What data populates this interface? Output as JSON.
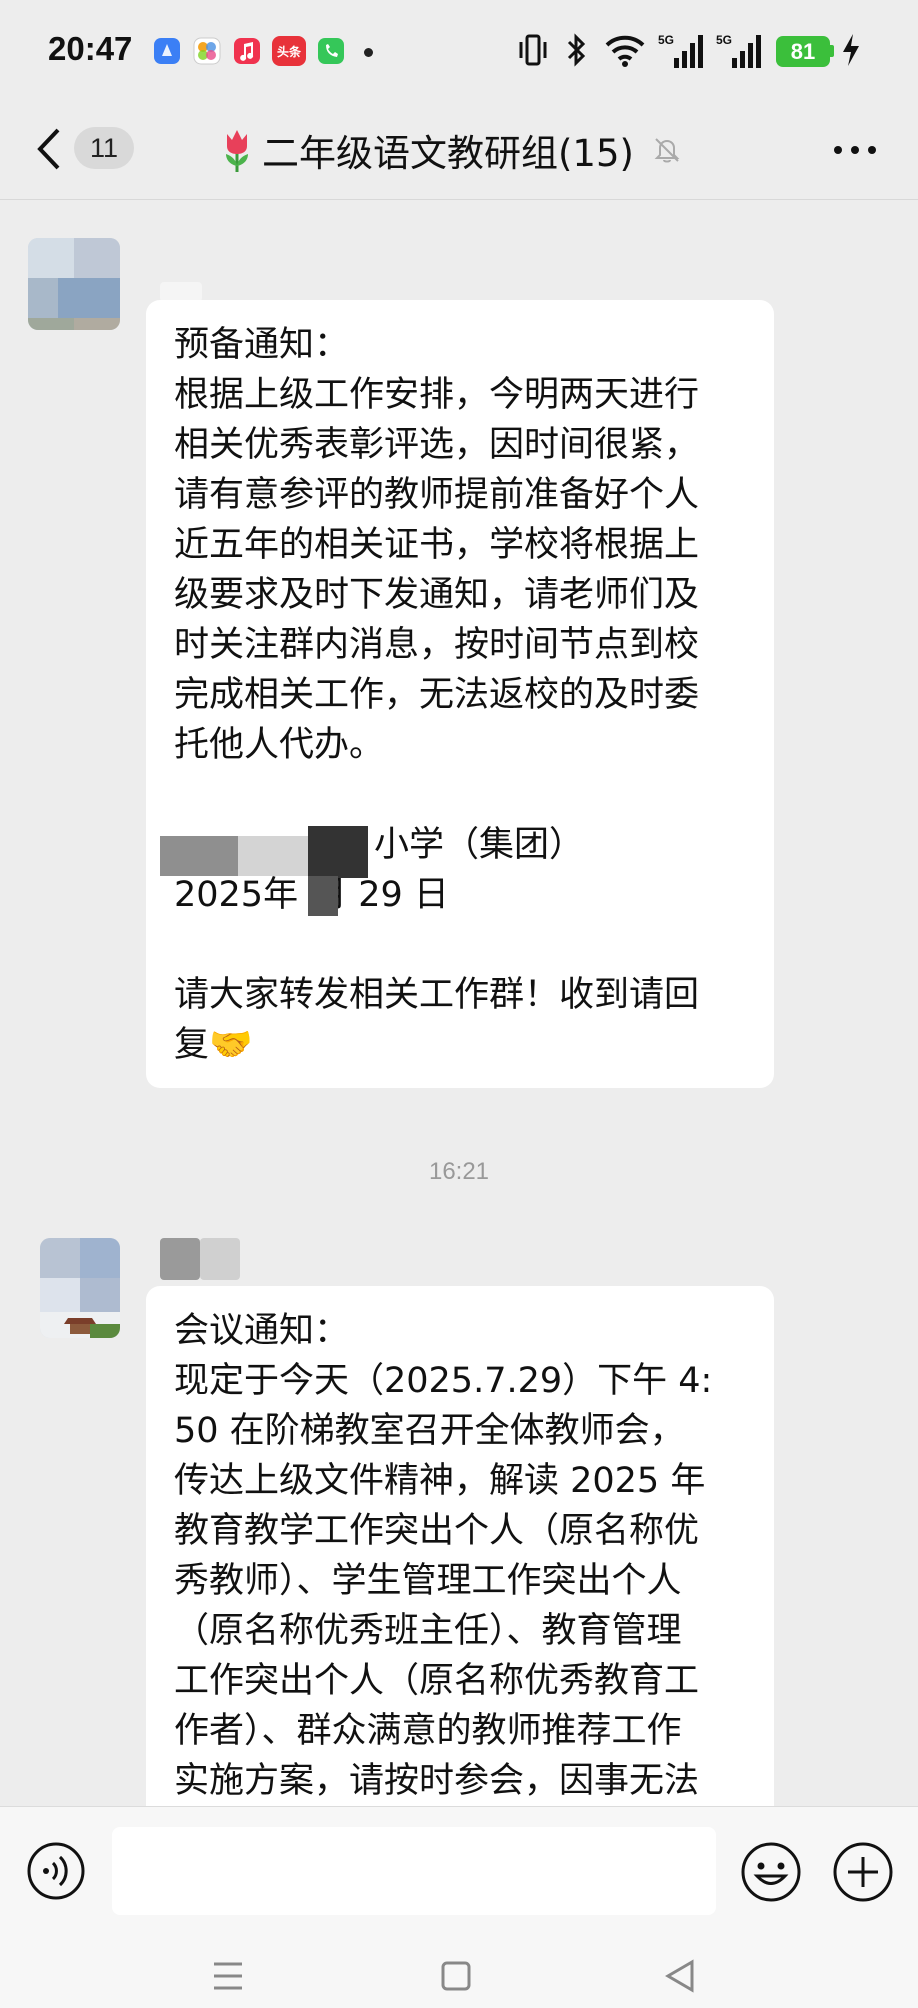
{
  "status_bar": {
    "time": "20:47",
    "battery": "81",
    "network": "5G",
    "icons": [
      "alipay-icon",
      "photos-icon",
      "music-icon",
      "toutiao-icon",
      "phone-icon",
      "vibrate-icon",
      "bluetooth-icon",
      "wifi-icon",
      "signal-icon",
      "charging-icon"
    ],
    "toutiao_label": "头条"
  },
  "header": {
    "unread_count": "11",
    "title": "二年级语文教研组(15)",
    "title_emoji": "tulip-icon",
    "muted": true
  },
  "messages": [
    {
      "paragraphs": [
        "预备通知：",
        "根据上级工作安排，今明两天进行",
        "相关优秀表彰评选，因时间很紧，",
        "请有意参评的教师提前准备好个人",
        "近五年的相关证书，学校将根据上",
        "级要求及时下发通知，请老师们及",
        "时关注群内消息，按时间节点到校",
        "完成相关工作，无法返校的及时委",
        "托他人代办。",
        "",
        "小学（集团）",
        "2025年",
        "月 29 日",
        "",
        "请大家转发相关工作群！收到请回",
        "复"
      ],
      "emoji": "🤝"
    },
    {
      "paragraphs": [
        "会议通知：",
        "现定于今天（2025.7.29）下午 4:",
        "50 在阶梯教室召开全体教师会，",
        "传达上级文件精神，解读 2025 年",
        "教育教学工作突出个人（原名称优",
        "秀教师）、学生管理工作突出个人",
        "（原名称优秀班主任）、教育管理",
        "工作突出个人（原名称优秀教育工",
        "作者）、群众满意的教师推荐工作",
        "实施方案，请按时参会，因事无法"
      ]
    }
  ],
  "timestamp": "16:21",
  "colors": {
    "background": "#ededed",
    "bubble": "#ffffff",
    "battery": "#3bbf3b"
  }
}
